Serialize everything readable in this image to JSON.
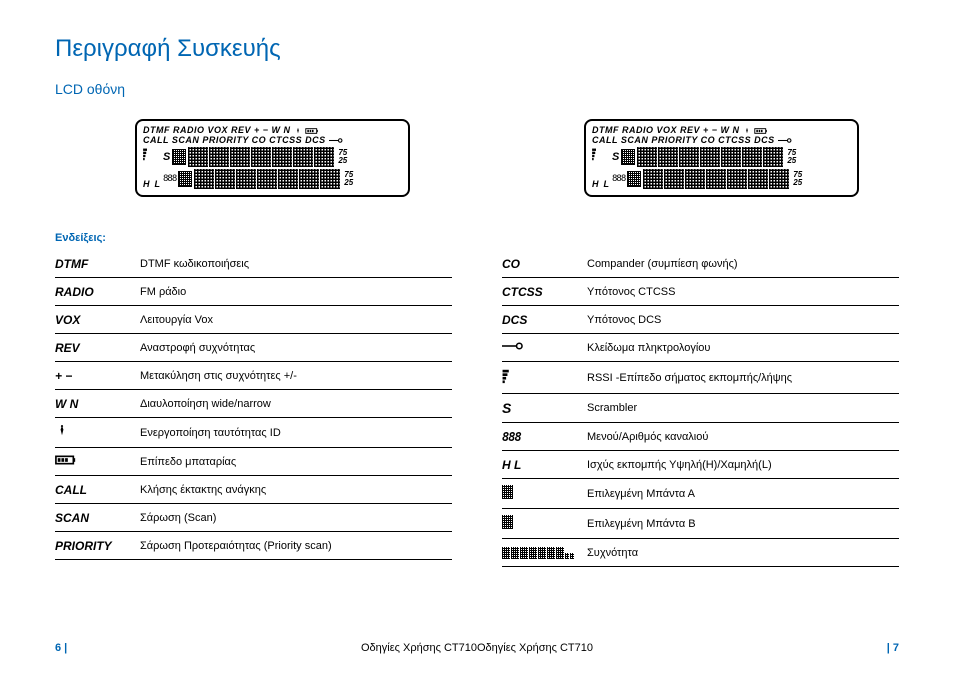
{
  "title": "Περιγραφή Συσκευής",
  "subtitle": "LCD οθόνη",
  "lcd": {
    "line1": "DTMF RADIO VOX REV + − W N",
    "line2": "CALL SCAN PRIORITY CO CTCSS DCS",
    "num_top": "75",
    "num_bot": "25",
    "s": "S",
    "h": "H",
    "l": "L",
    "n888": "888"
  },
  "indications_label": "Ενδείξεις:",
  "left_entries": [
    {
      "sym": "DTMF",
      "desc": "DTMF κωδικοποιήσεις"
    },
    {
      "sym": "RADIO",
      "desc": "FM ράδιο"
    },
    {
      "sym": "VOX",
      "desc": "Λειτουργία Vox"
    },
    {
      "sym": "REV",
      "desc": "Αναστροφή συχνότητας"
    },
    {
      "sym": "+ −",
      "desc": "Μετακύληση στις συχνότητες +/-"
    },
    {
      "sym": "W  N",
      "desc": "Διαυλοποίηση wide/narrow"
    },
    {
      "sym_icon": "bell",
      "desc": "Ενεργοποίηση ταυτότητας ID"
    },
    {
      "sym_icon": "battery",
      "desc": "Επίπεδο μπαταρίας"
    },
    {
      "sym": "CALL",
      "desc": "Κλήσης έκτακτης ανάγκης"
    },
    {
      "sym": "SCAN",
      "desc": "Σάρωση (Scan)"
    },
    {
      "sym": "PRIORITY",
      "desc": "Σάρωση Προτεραιότητας (Priority scan)"
    }
  ],
  "right_entries": [
    {
      "sym": "CO",
      "desc": "Compander (συμπίεση φωνής)"
    },
    {
      "sym": "CTCSS",
      "desc": "Υπότονος CTCSS"
    },
    {
      "sym": "DCS",
      "desc": "Υπότονος DCS"
    },
    {
      "sym_icon": "lock",
      "desc": "Κλείδωμα πληκτρολογίου"
    },
    {
      "sym_icon": "signal",
      "desc": "RSSI -Επίπεδο σήματος εκπομπής/λήψης"
    },
    {
      "sym_icon": "s",
      "desc": "Scrambler"
    },
    {
      "sym_icon": "888",
      "desc": "Μενού/Αριθμός καναλιού"
    },
    {
      "sym": "H   L",
      "desc": "Ισχύς εκπομπής Υψηλή(H)/Χαμηλή(L)"
    },
    {
      "sym_icon": "band-a",
      "desc": "Επιλεγμένη Μπάντα Α"
    },
    {
      "sym_icon": "band-b",
      "desc": "Επιλεγμένη Μπάντα Β"
    },
    {
      "sym_icon": "freq",
      "desc": "Συχνότητα"
    }
  ],
  "footer": {
    "left_page": "6 |",
    "right_page": "| 7",
    "manual": "Οδηγίες Χρήσης CT710"
  }
}
